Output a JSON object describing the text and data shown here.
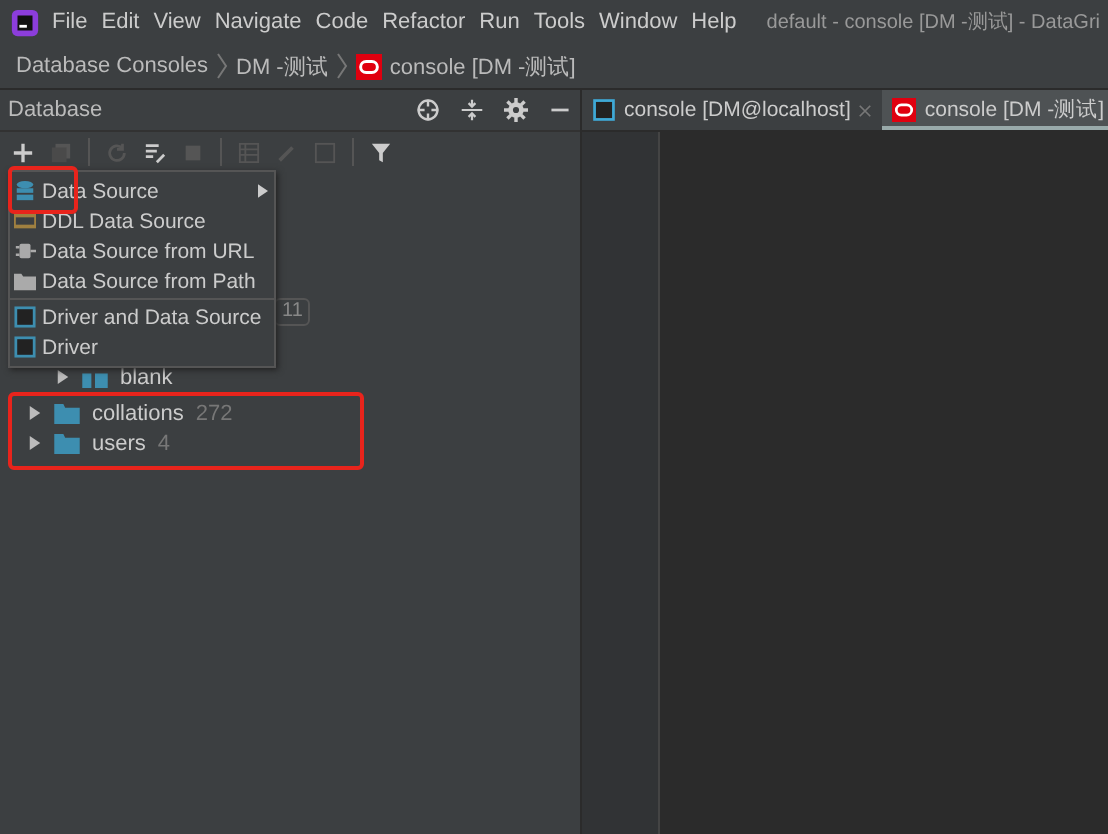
{
  "menu_bar": {
    "items": [
      "File",
      "Edit",
      "View",
      "Navigate",
      "Code",
      "Refactor",
      "Run",
      "Tools",
      "Window",
      "Help"
    ],
    "title": "default - console [DM -测试] - DataGri"
  },
  "breadcrumb": [
    "Database Consoles",
    "DM -测试",
    "console [DM -测试]"
  ],
  "database_panel": {
    "title": "Database",
    "tree": [
      {
        "kind": "badge-row",
        "count": "11",
        "children": [
          {
            "kind": "schema",
            "label": "blank"
          }
        ]
      },
      {
        "kind": "folder",
        "label": "collations",
        "count": "272"
      },
      {
        "kind": "folder",
        "label": "users",
        "count": "4"
      }
    ]
  },
  "popup_menu": {
    "groups": [
      [
        {
          "label": "Data Source",
          "submenu": true
        },
        {
          "label": "DDL Data Source",
          "submenu": false
        },
        {
          "label": "Data Source from URL",
          "submenu": false
        },
        {
          "label": "Data Source from Path",
          "submenu": false
        }
      ],
      [
        {
          "label": "Driver and Data Source",
          "submenu": false
        },
        {
          "label": "Driver",
          "submenu": false
        }
      ]
    ]
  },
  "editor_tabs": [
    {
      "label": "console [DM@localhost]",
      "selected": false
    },
    {
      "label": "console [DM -测试]",
      "selected": true
    }
  ]
}
